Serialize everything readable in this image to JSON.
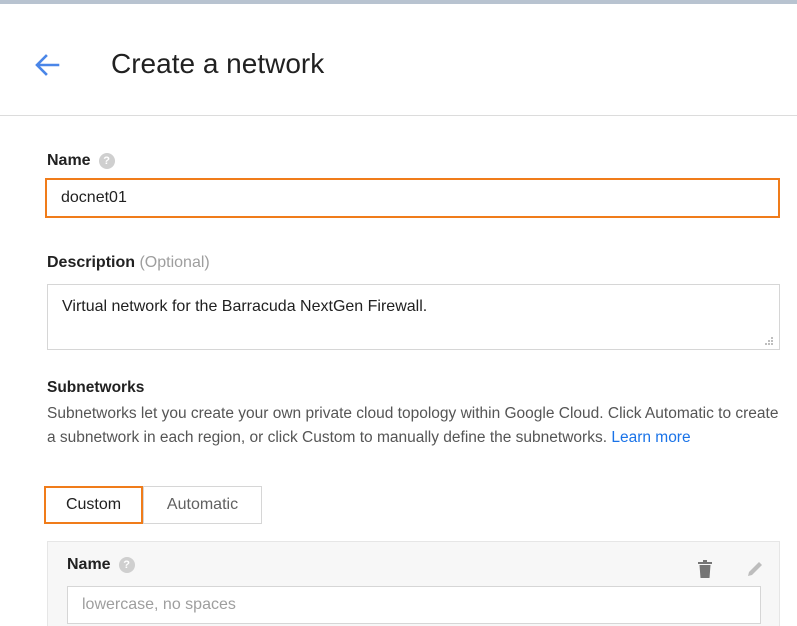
{
  "header": {
    "back_icon": "arrow-left-icon",
    "title": "Create a network"
  },
  "name_field": {
    "label": "Name",
    "help_icon": "question-circle-icon",
    "help_glyph": "?",
    "value": "docnet01"
  },
  "description_field": {
    "label": "Description",
    "optional": "(Optional)",
    "value": "Virtual network for the Barracuda NextGen Firewall."
  },
  "subnetworks": {
    "heading": "Subnetworks",
    "help_text": "Subnetworks let you create your own private cloud topology within Google Cloud. Click Automatic to create a subnetwork in each region, or click Custom to manually define the subnetworks.",
    "learn_more": "Learn more",
    "mode_options": [
      "Custom",
      "Automatic"
    ],
    "selected_mode": "Custom",
    "subnet": {
      "label": "Name",
      "help_glyph": "?",
      "placeholder": "lowercase, no spaces",
      "delete_icon": "trash-icon",
      "edit_icon": "pencil-icon"
    }
  },
  "colors": {
    "accent_border": "#f07c1a",
    "link": "#1a73e8",
    "back_arrow": "#4a86e8"
  }
}
